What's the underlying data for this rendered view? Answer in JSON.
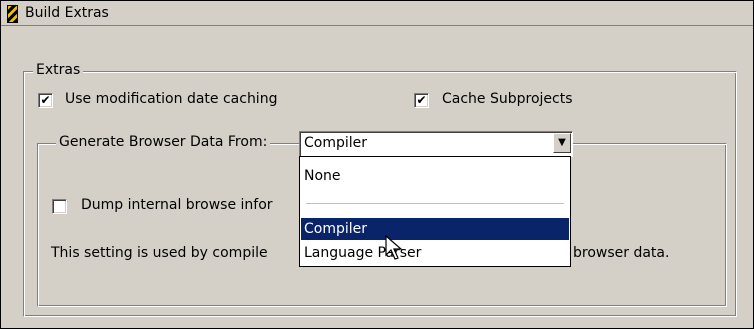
{
  "window": {
    "title": "Build Extras"
  },
  "extras_group": {
    "label": "Extras",
    "use_mod_date_caching": {
      "label": "Use modification date caching",
      "checked": true,
      "mark": "✔"
    },
    "cache_subprojects": {
      "label": "Cache Subprojects",
      "checked": true,
      "mark": "✔"
    }
  },
  "browser_group": {
    "label": "Generate Browser Data From:",
    "selected_value": "Compiler",
    "dump_label_visible": "Dump internal browse infor",
    "dump_checked": false,
    "description_left": "This setting is used by compile",
    "description_right": "browser data."
  },
  "dropdown": {
    "options": [
      {
        "label": "None"
      },
      {
        "label": "Compiler",
        "selected": true
      },
      {
        "label": "Language Parser"
      }
    ]
  }
}
